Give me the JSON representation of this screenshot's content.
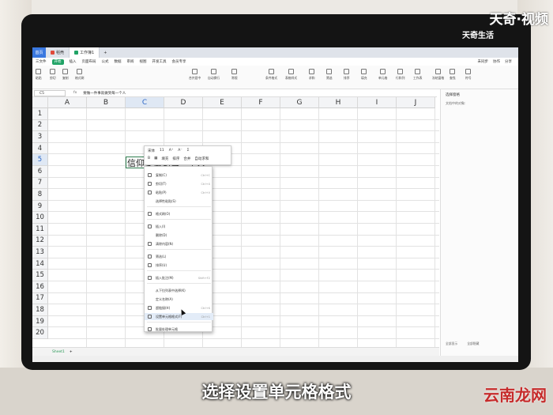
{
  "watermark": {
    "brand": "天奇·视频",
    "sub": "天奇生活"
  },
  "subtitle": "选择设置单元格格式",
  "corner_logo": "云南龙网",
  "app": {
    "tabs": [
      {
        "label": "首页"
      },
      {
        "label": "稻壳"
      },
      {
        "label": "工作簿1"
      }
    ],
    "menu": [
      "三文件",
      "开始",
      "插入",
      "页面布局",
      "公式",
      "数据",
      "审阅",
      "视图",
      "开发工具",
      "会员专享"
    ],
    "menu_right": [
      "未同步",
      "协作",
      "分享"
    ],
    "ribbon": [
      "粘贴",
      "剪切",
      "复制",
      "格式刷",
      "合并居中",
      "自动换行",
      "常规",
      "条件格式",
      "表格样式",
      "求和",
      "筛选",
      "排序",
      "填充",
      "单元格",
      "行和列",
      "工作表",
      "冻结窗格",
      "查找",
      "符号"
    ],
    "name_box": "C5",
    "fx": "fx",
    "formula": "要做一件事就做到每一个人"
  },
  "grid": {
    "columns": [
      "A",
      "B",
      "C",
      "D",
      "E",
      "F",
      "G",
      "H",
      "I",
      "J"
    ],
    "selected_col": "C",
    "rows": [
      "1",
      "2",
      "3",
      "4",
      "5",
      "6",
      "7",
      "8",
      "9",
      "10",
      "11",
      "12",
      "13",
      "14",
      "15",
      "16",
      "17",
      "18",
      "19",
      "20"
    ],
    "selected_row": "5",
    "cell_text": "信仰要做到每一个人"
  },
  "sheet_tab": "Sheet1",
  "right_pane": {
    "title": "选择窗格",
    "subtitle": "文档中的对象:",
    "buttons": [
      "全部显示",
      "全部隐藏"
    ]
  },
  "mini_toolbar": {
    "font": "宋体",
    "size": "11",
    "row2": [
      "填充",
      "排序",
      "合并",
      "自动求和"
    ]
  },
  "context_menu": [
    {
      "label": "复制(C)",
      "shortcut": "Ctrl+C"
    },
    {
      "label": "剪切(T)",
      "shortcut": "Ctrl+X"
    },
    {
      "label": "粘贴(P)",
      "shortcut": "Ctrl+V"
    },
    {
      "label": "选择性粘贴(S)",
      "shortcut": ""
    },
    {
      "label": "格式刷(O)",
      "shortcut": ""
    },
    {
      "label": "插入(I)",
      "shortcut": ""
    },
    {
      "label": "删除(D)",
      "shortcut": ""
    },
    {
      "label": "清除内容(N)",
      "shortcut": ""
    },
    {
      "label": "筛选(L)",
      "shortcut": ""
    },
    {
      "label": "排序(U)",
      "shortcut": ""
    },
    {
      "label": "插入批注(M)",
      "shortcut": "Shift+F2"
    },
    {
      "label": "从下拉列表中选择(K)",
      "shortcut": ""
    },
    {
      "label": "定义名称(A)",
      "shortcut": ""
    },
    {
      "label": "超链接(H)",
      "shortcut": "Ctrl+K"
    },
    {
      "label": "设置单元格格式(F)",
      "shortcut": "Ctrl+1"
    },
    {
      "label": "批量处理单元格",
      "shortcut": ""
    }
  ]
}
